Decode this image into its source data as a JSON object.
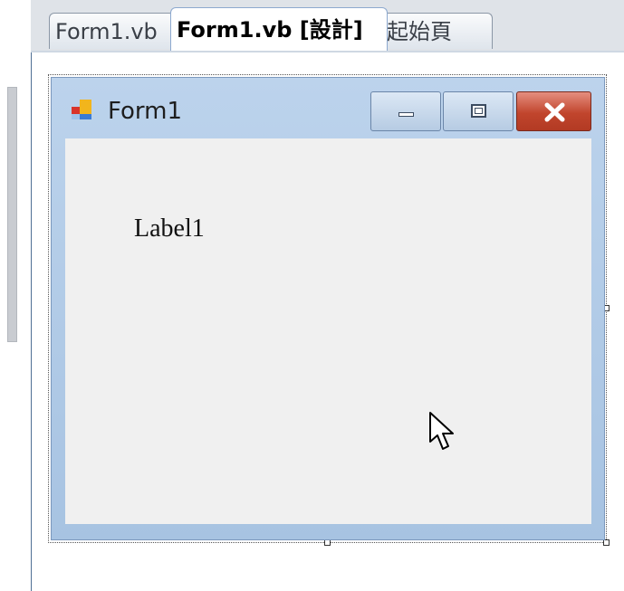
{
  "tabs": [
    {
      "label": "Form1.vb",
      "active": false
    },
    {
      "label": "Form1.vb [設計]",
      "active": true
    },
    {
      "label": "起始頁",
      "active": false
    }
  ],
  "form": {
    "title": "Form1",
    "label_text": "Label1",
    "controls": {
      "minimize": "minimize",
      "maximize": "maximize",
      "close": "close"
    }
  },
  "colors": {
    "close_button": "#c1452d",
    "form_frame": "#bcd3ec",
    "client_area": "#f0f0f0"
  },
  "icons": [
    "form-app-icon",
    "minimize-icon",
    "maximize-icon",
    "close-icon",
    "mouse-cursor-icon"
  ]
}
